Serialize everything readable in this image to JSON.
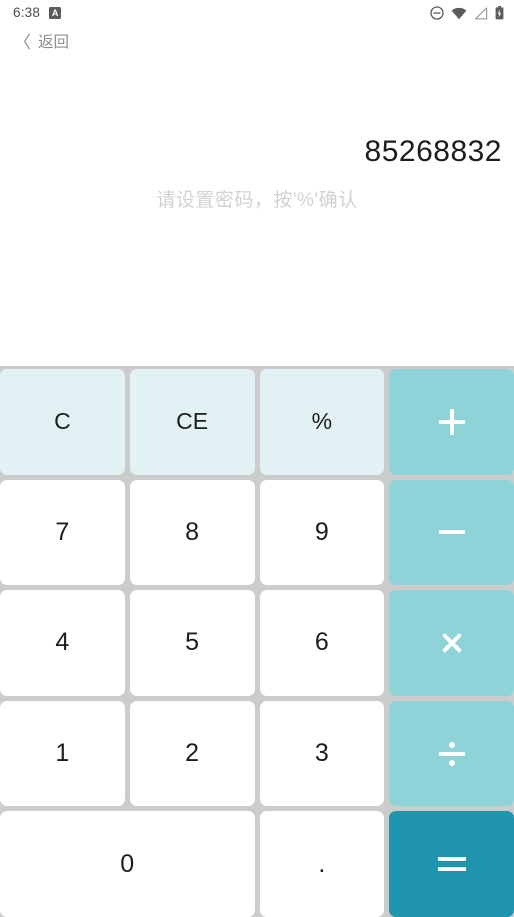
{
  "status_bar": {
    "time": "6:38",
    "app_badge_label": "A",
    "icons": [
      {
        "name": "do-not-disturb-icon",
        "title": "Do not disturb"
      },
      {
        "name": "wifi-icon",
        "title": "Wi-Fi"
      },
      {
        "name": "signal-icon",
        "title": "Mobile signal"
      },
      {
        "name": "battery-charging-icon",
        "title": "Battery charging"
      }
    ]
  },
  "nav": {
    "back_chevron": "〈",
    "back_label": "返回"
  },
  "display": {
    "expression": "85268832",
    "hint": "请设置密码，按'%'确认"
  },
  "keypad": {
    "keys": [
      {
        "label": "C",
        "name": "key-clear",
        "type": "func"
      },
      {
        "label": "CE",
        "name": "key-clear-entry",
        "type": "func"
      },
      {
        "label": "%",
        "name": "key-percent",
        "type": "func"
      },
      {
        "label": "+",
        "name": "key-plus",
        "type": "op"
      },
      {
        "label": "7",
        "name": "key-7",
        "type": "num"
      },
      {
        "label": "8",
        "name": "key-8",
        "type": "num"
      },
      {
        "label": "9",
        "name": "key-9",
        "type": "num"
      },
      {
        "label": "−",
        "name": "key-minus",
        "type": "op"
      },
      {
        "label": "4",
        "name": "key-4",
        "type": "num"
      },
      {
        "label": "5",
        "name": "key-5",
        "type": "num"
      },
      {
        "label": "6",
        "name": "key-6",
        "type": "num"
      },
      {
        "label": "×",
        "name": "key-multiply",
        "type": "op"
      },
      {
        "label": "1",
        "name": "key-1",
        "type": "num"
      },
      {
        "label": "2",
        "name": "key-2",
        "type": "num"
      },
      {
        "label": "3",
        "name": "key-3",
        "type": "num"
      },
      {
        "label": "÷",
        "name": "key-divide",
        "type": "op"
      },
      {
        "label": "0",
        "name": "key-0",
        "type": "num",
        "wide": true
      },
      {
        "label": ".",
        "name": "key-decimal",
        "type": "num"
      },
      {
        "label": "=",
        "name": "key-equals",
        "type": "equals"
      }
    ]
  },
  "colors": {
    "operator": "#8dd3d8",
    "equals": "#1f96ae",
    "function_key": "#e2f2f4",
    "number_key": "#ffffff",
    "keypad_gutter": "#cccccc",
    "hint_text": "#d2d2d2",
    "expression_text": "#1d1d1d"
  }
}
